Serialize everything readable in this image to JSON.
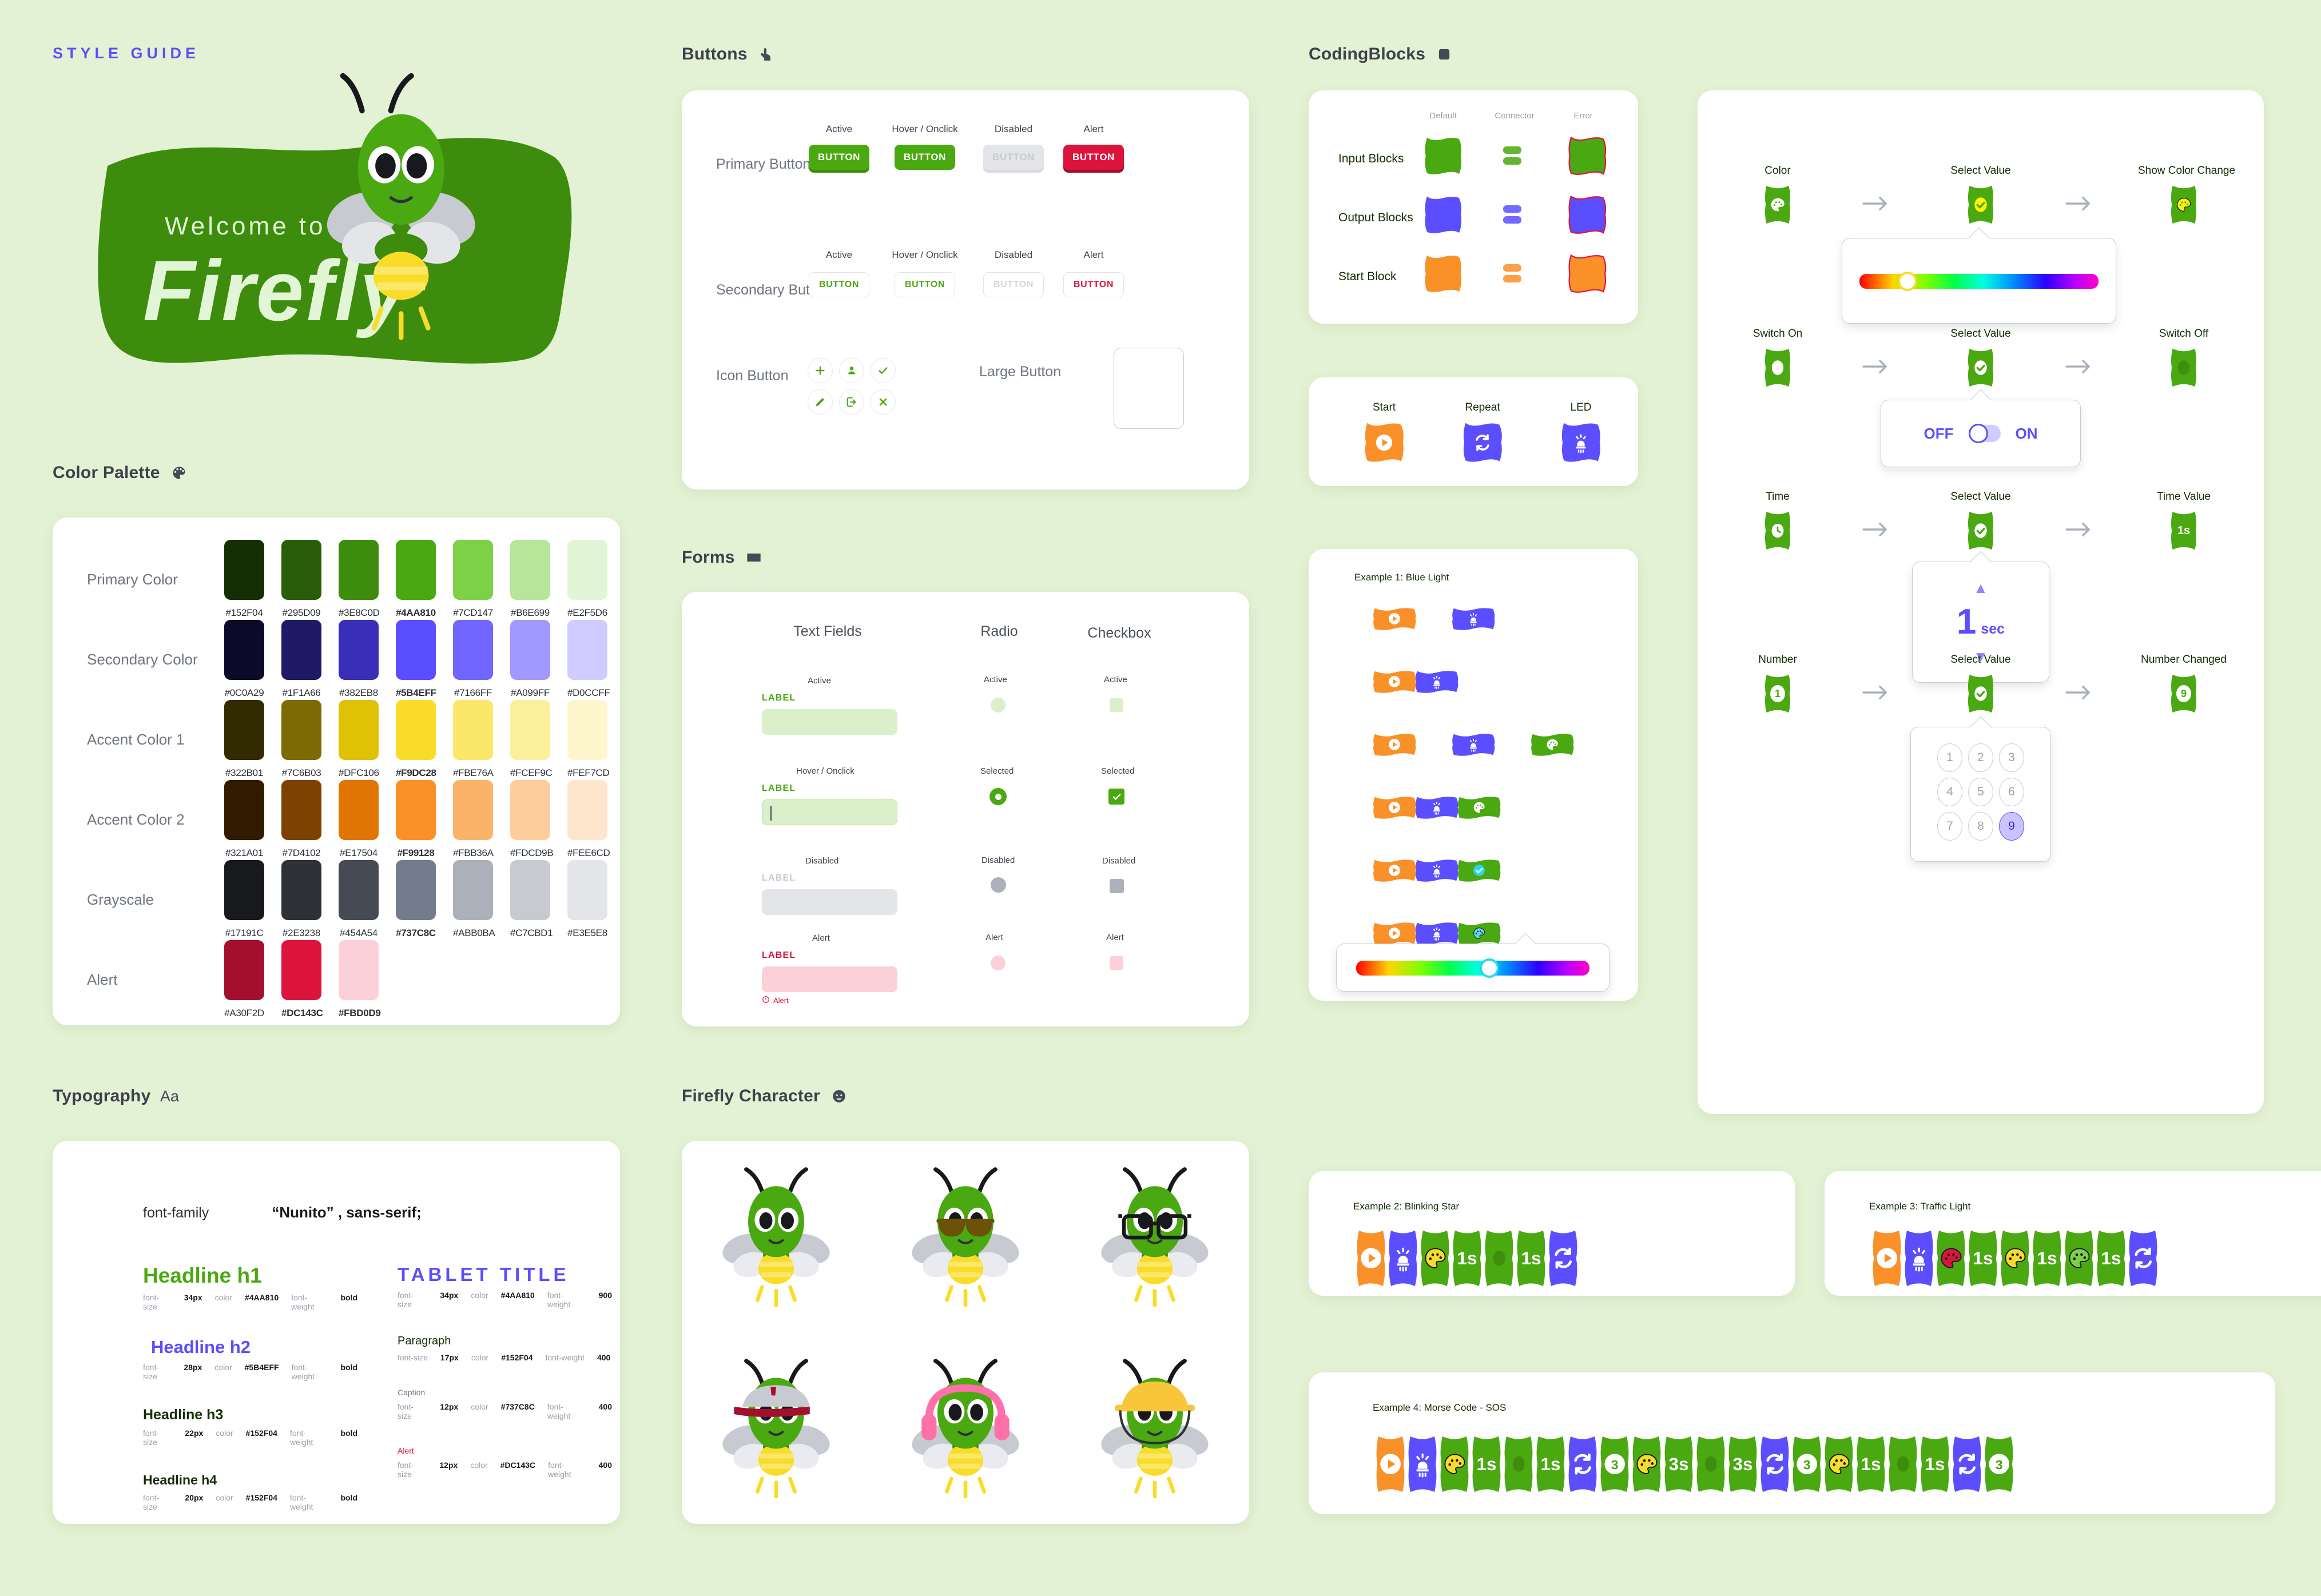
{
  "brand": {
    "style_guide_label": "STYLE GUIDE",
    "welcome_text": "Welcome to",
    "logo_text": "Firefly"
  },
  "color_palette": {
    "section_title": "Color Palette",
    "section_icon": "palette-icon",
    "rows": [
      {
        "name": "Primary Color",
        "swatches": [
          {
            "hex": "#152F04",
            "key": false
          },
          {
            "hex": "#295D09",
            "key": false
          },
          {
            "hex": "#3E8C0D",
            "key": false
          },
          {
            "hex": "#4AA810",
            "key": true
          },
          {
            "hex": "#7CD147",
            "key": false
          },
          {
            "hex": "#B6E699",
            "key": false
          },
          {
            "hex": "#E2F5D6",
            "key": false
          }
        ]
      },
      {
        "name": "Secondary Color",
        "swatches": [
          {
            "hex": "#0C0A29",
            "key": false
          },
          {
            "hex": "#1F1A66",
            "key": false
          },
          {
            "hex": "#382EB8",
            "key": false
          },
          {
            "hex": "#5B4EFF",
            "key": true
          },
          {
            "hex": "#7166FF",
            "key": false
          },
          {
            "hex": "#A099FF",
            "key": false
          },
          {
            "hex": "#D0CCFF",
            "key": false
          }
        ]
      },
      {
        "name": "Accent Color 1",
        "swatches": [
          {
            "hex": "#322B01",
            "key": false
          },
          {
            "hex": "#7C6B03",
            "key": false
          },
          {
            "hex": "#DFC106",
            "key": false
          },
          {
            "hex": "#F9DC28",
            "key": true
          },
          {
            "hex": "#FBE76A",
            "key": false
          },
          {
            "hex": "#FCEF9C",
            "key": false
          },
          {
            "hex": "#FEF7CD",
            "key": false
          }
        ]
      },
      {
        "name": "Accent Color 2",
        "swatches": [
          {
            "hex": "#321A01",
            "key": false
          },
          {
            "hex": "#7D4102",
            "key": false
          },
          {
            "hex": "#E17504",
            "key": false
          },
          {
            "hex": "#F99128",
            "key": true
          },
          {
            "hex": "#FBB36A",
            "key": false
          },
          {
            "hex": "#FDCD9B",
            "key": false
          },
          {
            "hex": "#FEE6CD",
            "key": false
          }
        ]
      },
      {
        "name": "Grayscale",
        "swatches": [
          {
            "hex": "#17191C",
            "key": false
          },
          {
            "hex": "#2E3238",
            "key": false
          },
          {
            "hex": "#454A54",
            "key": false
          },
          {
            "hex": "#737C8C",
            "key": true
          },
          {
            "hex": "#ABB0BA",
            "key": false
          },
          {
            "hex": "#C7CBD1",
            "key": false
          },
          {
            "hex": "#E3E5E8",
            "key": false
          }
        ]
      },
      {
        "name": "Alert",
        "swatches": [
          {
            "hex": "#A30F2D",
            "key": false
          },
          {
            "hex": "#DC143C",
            "key": true
          },
          {
            "hex": "#FBD0D9",
            "key": true
          }
        ]
      }
    ]
  },
  "typography": {
    "section_title": "Typography",
    "section_icon": "aa-icon",
    "font_family_key": "font-family",
    "font_family_value": "“Nunito” , sans-serif;",
    "meta_keys": {
      "size": "font-size",
      "color": "color",
      "weight": "font-weight"
    },
    "left": [
      {
        "sample": "Headline h1",
        "size": "34px",
        "color": "#4AA810",
        "weight": "bold"
      },
      {
        "sample": "Headline h2",
        "size": "28px",
        "color": "#5B4EFF",
        "weight": "bold"
      },
      {
        "sample": "Headline h3",
        "size": "22px",
        "color": "#152F04",
        "weight": "bold"
      },
      {
        "sample": "Headline h4",
        "size": "20px",
        "color": "#152F04",
        "weight": "bold"
      }
    ],
    "right": [
      {
        "sample": "TABLET TITLE",
        "size": "34px",
        "color": "#4AA810",
        "weight": "900"
      },
      {
        "sample": "Paragraph",
        "size": "17px",
        "color": "#152F04",
        "weight": "400"
      },
      {
        "sample": "Caption",
        "size": "12px",
        "color": "#737C8C",
        "weight": "400"
      },
      {
        "sample": "Alert",
        "size": "12px",
        "color": "#DC143C",
        "weight": "400"
      }
    ]
  },
  "buttons": {
    "section_title": "Buttons",
    "section_icon": "pointing-hand-icon",
    "states": [
      "Active",
      "Hover / Onclick",
      "Disabled",
      "Alert"
    ],
    "primary_row_label": "Primary Button",
    "secondary_row_label": "Secondary Button",
    "button_text": "BUTTON",
    "icon_row_label": "Icon Button",
    "large_row_label": "Large Button",
    "icons": [
      "plus-icon",
      "user-icon",
      "check-icon",
      "pencil-icon",
      "logout-icon",
      "close-x-icon"
    ]
  },
  "forms": {
    "section_title": "Forms",
    "section_icon": "keyboard-icon",
    "columns": [
      "Text Fields",
      "Radio",
      "Checkbox"
    ],
    "text_states": [
      "Active",
      "Hover / Onclick",
      "Disabled",
      "Alert"
    ],
    "choice_states": [
      "Active",
      "Selected",
      "Disabled",
      "Alert"
    ],
    "label_text": "LABEL",
    "alert_helper": "Alert"
  },
  "firefly_character": {
    "section_title": "Firefly Character",
    "section_icon": "smiley-icon",
    "variants": [
      "plain",
      "sunglasses",
      "nerd-glasses",
      "cap",
      "headphones",
      "hard-hat"
    ]
  },
  "coding_blocks": {
    "section_title": "CodingBlocks",
    "section_icon": "rounded-square-icon",
    "columns": [
      "Default",
      "Connector",
      "Error"
    ],
    "rows": [
      {
        "label": "Input Blocks",
        "color": "#4AA810"
      },
      {
        "label": "Output Blocks",
        "color": "#5B4EFF"
      },
      {
        "label": "Start Block",
        "color": "#F99128"
      }
    ],
    "error_stroke": "#DC143C"
  },
  "block_types": {
    "items": [
      {
        "label": "Start",
        "icon": "play-icon",
        "color": "#F99128"
      },
      {
        "label": "Repeat",
        "icon": "repeat-icon",
        "color": "#5B4EFF"
      },
      {
        "label": "LED",
        "icon": "led-icon",
        "color": "#5B4EFF"
      }
    ]
  },
  "example1": {
    "title": "Example 1: Blue Light",
    "steps": [
      {
        "blocks": [
          "play",
          "led"
        ],
        "joined": false
      },
      {
        "blocks": [
          "play",
          "led"
        ],
        "joined": true
      },
      {
        "blocks": [
          "play",
          "led",
          "palette"
        ],
        "joined": false
      },
      {
        "blocks": [
          "play",
          "led",
          "palette"
        ],
        "joined": true
      },
      {
        "blocks": [
          "play",
          "led",
          "check"
        ],
        "joined": true
      },
      {
        "blocks": [
          "play",
          "led",
          "palette-blue"
        ],
        "joined": true
      }
    ],
    "slider_value_label": "",
    "slider_knob_percent": 57
  },
  "interactions": {
    "rows": [
      {
        "start_label": "Color",
        "start_icon": "palette-icon",
        "middle_label": "Select Value",
        "middle_icon": "check-icon",
        "end_label": "Show Color Change",
        "end_icon": "palette-yellow-icon",
        "popover": "hue-slider",
        "knob_percent": 20,
        "knob_color": "#F9DC28"
      },
      {
        "start_label": "Switch On",
        "start_icon": "switch-on-icon",
        "middle_label": "Select Value",
        "middle_icon": "check-icon",
        "end_label": "Switch Off",
        "end_icon": "switch-off-icon",
        "popover": "toggle",
        "toggle_off_label": "OFF",
        "toggle_on_label": "ON",
        "toggle_state": "off"
      },
      {
        "start_label": "Time",
        "start_icon": "clock-icon",
        "middle_label": "Select Value",
        "middle_icon": "check-icon",
        "end_label": "Time Value",
        "end_icon": "time-value-icon",
        "end_value": "1s",
        "popover": "stepper",
        "stepper_value": "1",
        "stepper_unit": "sec"
      },
      {
        "start_label": "Number",
        "start_icon": "number-icon",
        "start_value": "1",
        "middle_label": "Select Value",
        "middle_icon": "check-icon",
        "end_label": "Number Changed",
        "end_icon": "number-icon",
        "end_value": "9",
        "popover": "numpad",
        "keys": [
          "1",
          "2",
          "3",
          "4",
          "5",
          "6",
          "7",
          "8",
          "9"
        ],
        "selected_key": "9"
      }
    ]
  },
  "example2": {
    "title": "Example 2: Blinking Star",
    "blocks": [
      {
        "icon": "play",
        "color": "#F99128"
      },
      {
        "icon": "led",
        "color": "#5B4EFF"
      },
      {
        "icon": "palette-yellow",
        "color": "#4AA810"
      },
      {
        "icon": "text",
        "text": "1s",
        "color": "#4AA810"
      },
      {
        "icon": "switch-off",
        "color": "#4AA810"
      },
      {
        "icon": "text",
        "text": "1s",
        "color": "#4AA810"
      },
      {
        "icon": "repeat",
        "color": "#5B4EFF"
      }
    ]
  },
  "example3": {
    "title": "Example 3: Traffic Light",
    "blocks": [
      {
        "icon": "play",
        "color": "#F99128"
      },
      {
        "icon": "led",
        "color": "#5B4EFF"
      },
      {
        "icon": "palette-red",
        "color": "#4AA810"
      },
      {
        "icon": "text",
        "text": "1s",
        "color": "#4AA810"
      },
      {
        "icon": "palette-yellow",
        "color": "#4AA810"
      },
      {
        "icon": "text",
        "text": "1s",
        "color": "#4AA810"
      },
      {
        "icon": "palette-green",
        "color": "#4AA810"
      },
      {
        "icon": "text",
        "text": "1s",
        "color": "#4AA810"
      },
      {
        "icon": "repeat",
        "color": "#5B4EFF"
      }
    ]
  },
  "example4": {
    "title": "Example 4: Morse Code - SOS",
    "blocks": [
      {
        "icon": "play",
        "color": "#F99128"
      },
      {
        "icon": "led",
        "color": "#5B4EFF"
      },
      {
        "icon": "palette-yellow",
        "color": "#4AA810"
      },
      {
        "icon": "text",
        "text": "1s",
        "color": "#4AA810"
      },
      {
        "icon": "switch-off",
        "color": "#4AA810"
      },
      {
        "icon": "text",
        "text": "1s",
        "color": "#4AA810"
      },
      {
        "icon": "repeat",
        "color": "#5B4EFF"
      },
      {
        "icon": "circled",
        "text": "3",
        "color": "#4AA810"
      },
      {
        "icon": "palette-yellow",
        "color": "#4AA810"
      },
      {
        "icon": "text",
        "text": "3s",
        "color": "#4AA810"
      },
      {
        "icon": "switch-off",
        "color": "#4AA810"
      },
      {
        "icon": "text",
        "text": "3s",
        "color": "#4AA810"
      },
      {
        "icon": "repeat",
        "color": "#5B4EFF"
      },
      {
        "icon": "circled",
        "text": "3",
        "color": "#4AA810"
      },
      {
        "icon": "palette-yellow",
        "color": "#4AA810"
      },
      {
        "icon": "text",
        "text": "1s",
        "color": "#4AA810"
      },
      {
        "icon": "switch-off",
        "color": "#4AA810"
      },
      {
        "icon": "text",
        "text": "1s",
        "color": "#4AA810"
      },
      {
        "icon": "repeat",
        "color": "#5B4EFF"
      },
      {
        "icon": "circled",
        "text": "3",
        "color": "#4AA810"
      }
    ]
  },
  "palette_colors": {
    "bg": "#E3F2D4",
    "primary": "#4AA810",
    "secondary": "#5B4EFF",
    "accent1": "#F9DC28",
    "accent2": "#F99128",
    "gray": "#737C8C",
    "alert": "#DC143C"
  }
}
